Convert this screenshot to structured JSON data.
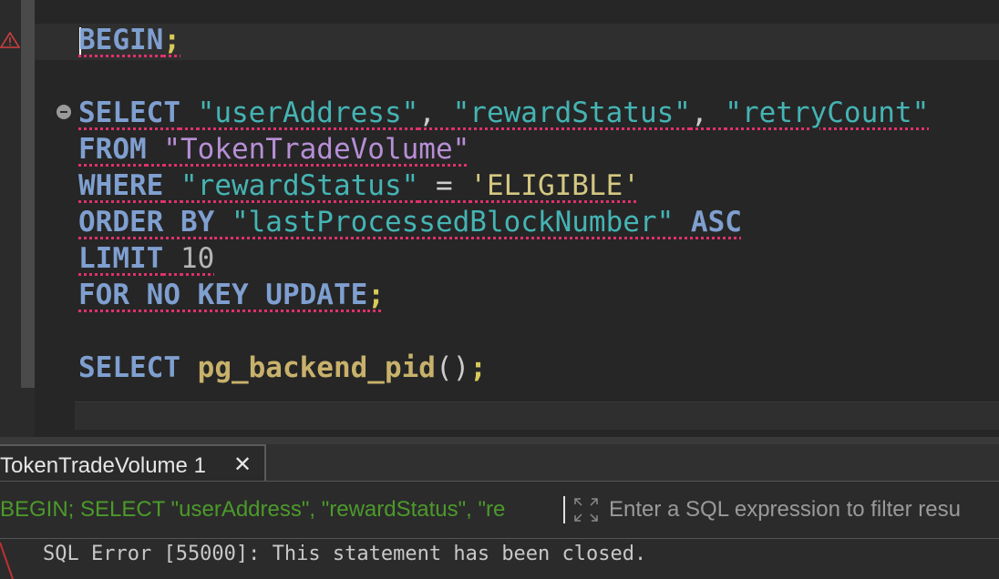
{
  "editor": {
    "lines": {
      "begin": {
        "kw": "BEGIN",
        "semi": ";"
      },
      "select1": {
        "kw": "SELECT",
        "c1": "\"userAddress\"",
        "comma1": ",",
        "c2": "\"rewardStatus\"",
        "comma2": ",",
        "c3": "\"retryCount\""
      },
      "from": {
        "kw": "FROM",
        "table": "\"TokenTradeVolume\""
      },
      "where": {
        "kw": "WHERE",
        "col": "\"rewardStatus\"",
        "op": "=",
        "val": "'ELIGIBLE'"
      },
      "order": {
        "kw": "ORDER BY",
        "col": "\"lastProcessedBlockNumber\"",
        "dir": "ASC"
      },
      "limit": {
        "kw": "LIMIT",
        "num": "10"
      },
      "forupdate": {
        "kw": "FOR NO KEY UPDATE",
        "semi": ";"
      },
      "select2": {
        "kw": "SELECT",
        "fn": "pg_backend_pid",
        "paren": "()",
        "semi": ";"
      }
    }
  },
  "results": {
    "tab_label": "TokenTradeVolume 1",
    "close_glyph": "✕",
    "query_text": "BEGIN; SELECT \"userAddress\", \"rewardStatus\", \"re",
    "filter_placeholder": "Enter a SQL expression to filter resu",
    "error_message": "SQL Error [55000]: This statement has been closed."
  },
  "colors": {
    "keyword": "#7f9fd0",
    "identifier": "#45b4b4",
    "string": "#d4c882",
    "function": "#c8b26b",
    "error_underline": "#e0306d",
    "query_green": "#4c9a2a"
  }
}
